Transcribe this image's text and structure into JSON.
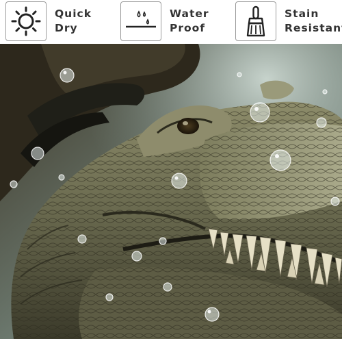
{
  "features": [
    {
      "icon": "sun-icon",
      "line1": "Quick",
      "line2": "Dry"
    },
    {
      "icon": "water-drops-icon",
      "line1": "Water",
      "line2": "Proof"
    },
    {
      "icon": "brush-icon",
      "line1": "Stain",
      "line2": "Resistant"
    }
  ],
  "colors": {
    "text": "#333333",
    "icon_stroke": "#222222",
    "icon_border": "#9a9a9a",
    "water_bg": "#8fa3a0",
    "croc_dark": "#2a2a1e",
    "croc_mid": "#6b6a4f",
    "croc_light": "#b9b693"
  }
}
